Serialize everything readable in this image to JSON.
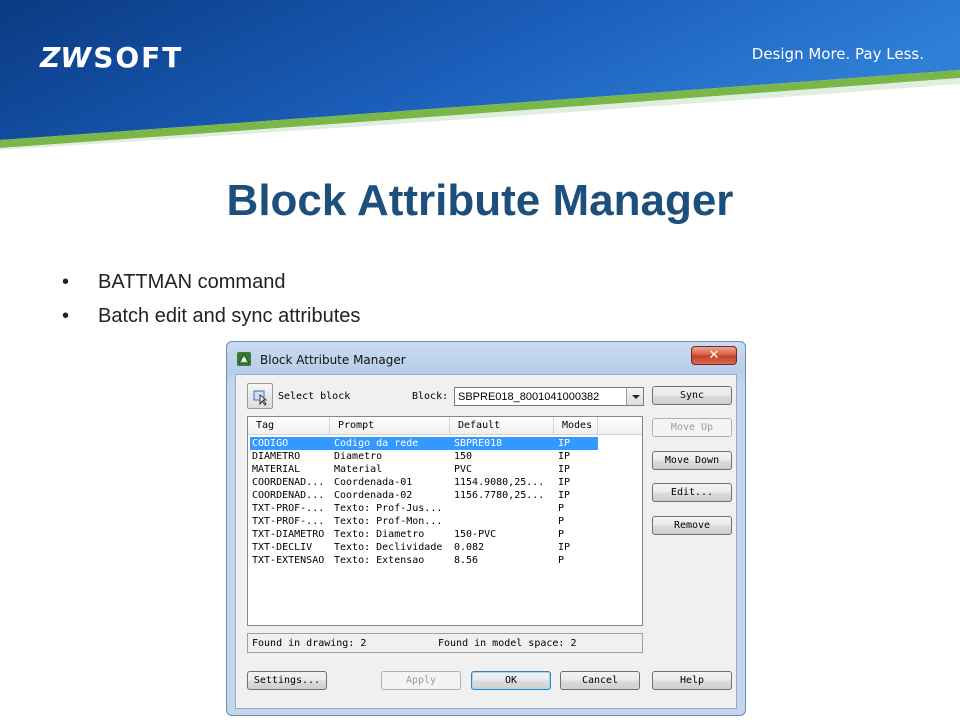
{
  "slide": {
    "logo_text_a": "ZW",
    "logo_text_b": "SOFT",
    "tagline": "Design More. Pay Less.",
    "title": "Block Attribute Manager",
    "bullets": [
      "BATTMAN command",
      "Batch edit and sync attributes"
    ],
    "colors": {
      "banner_dark": "#0a3a82",
      "banner_light": "#2f7fd6",
      "accent_green": "#7ab648",
      "title": "#1c4f7c"
    }
  },
  "dialog": {
    "title": "Block Attribute Manager",
    "close_glyph": "✕",
    "select_block_label": "Select block",
    "block_label": "Block:",
    "block_value": "SBPRE018_8001041000382",
    "columns": [
      "Tag",
      "Prompt",
      "Default",
      "Modes"
    ],
    "rows": [
      {
        "tag": "CODIGO",
        "prompt": "Codigo da rede",
        "default": "SBPRE018",
        "modes": "IP",
        "selected": true
      },
      {
        "tag": "DIAMETRO",
        "prompt": "Diametro",
        "default": "150",
        "modes": "IP"
      },
      {
        "tag": "MATERIAL",
        "prompt": "Material",
        "default": "PVC",
        "modes": "IP"
      },
      {
        "tag": "COORDENAD...",
        "prompt": "Coordenada-01",
        "default": "1154.9080,25...",
        "modes": "IP"
      },
      {
        "tag": "COORDENAD...",
        "prompt": "Coordenada-02",
        "default": "1156.7780,25...",
        "modes": "IP"
      },
      {
        "tag": "TXT-PROF-...",
        "prompt": "Texto: Prof-Jus...",
        "default": "",
        "modes": "P"
      },
      {
        "tag": "TXT-PROF-...",
        "prompt": "Texto: Prof-Mon...",
        "default": "",
        "modes": "P"
      },
      {
        "tag": "TXT-DIAMETRO",
        "prompt": "Texto: Diametro",
        "default": "  150-PVC",
        "modes": "P"
      },
      {
        "tag": "TXT-DECLIV",
        "prompt": "Texto: Declividade",
        "default": "0.082",
        "modes": "IP"
      },
      {
        "tag": "TXT-EXTENSAO",
        "prompt": "Texto: Extensao",
        "default": "8.56",
        "modes": "P"
      }
    ],
    "status_drawing": "Found in drawing: 2",
    "status_model": "Found in model space: 2",
    "side_buttons": {
      "sync": "Sync",
      "move_up": "Move Up",
      "move_down": "Move Down",
      "edit": "Edit...",
      "remove": "Remove"
    },
    "bottom_buttons": {
      "settings": "Settings...",
      "apply": "Apply",
      "ok": "OK",
      "cancel": "Cancel",
      "help": "Help"
    }
  }
}
